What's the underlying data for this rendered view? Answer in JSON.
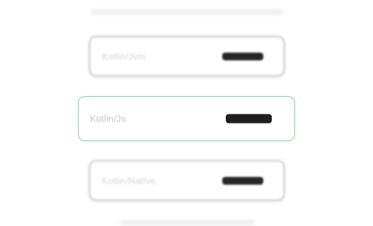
{
  "picker": {
    "items": [
      {
        "label": "",
        "state": "edge-top"
      },
      {
        "label": "Kotlin/Jvm",
        "state": "blurred"
      },
      {
        "label": "Kotlin/Js",
        "state": "focused"
      },
      {
        "label": "Kotlin/Native",
        "state": "blurred"
      },
      {
        "label": "",
        "state": "edge-bottom"
      }
    ],
    "focus_color": "#7bd88a",
    "value_color": "#1f1f1f"
  }
}
